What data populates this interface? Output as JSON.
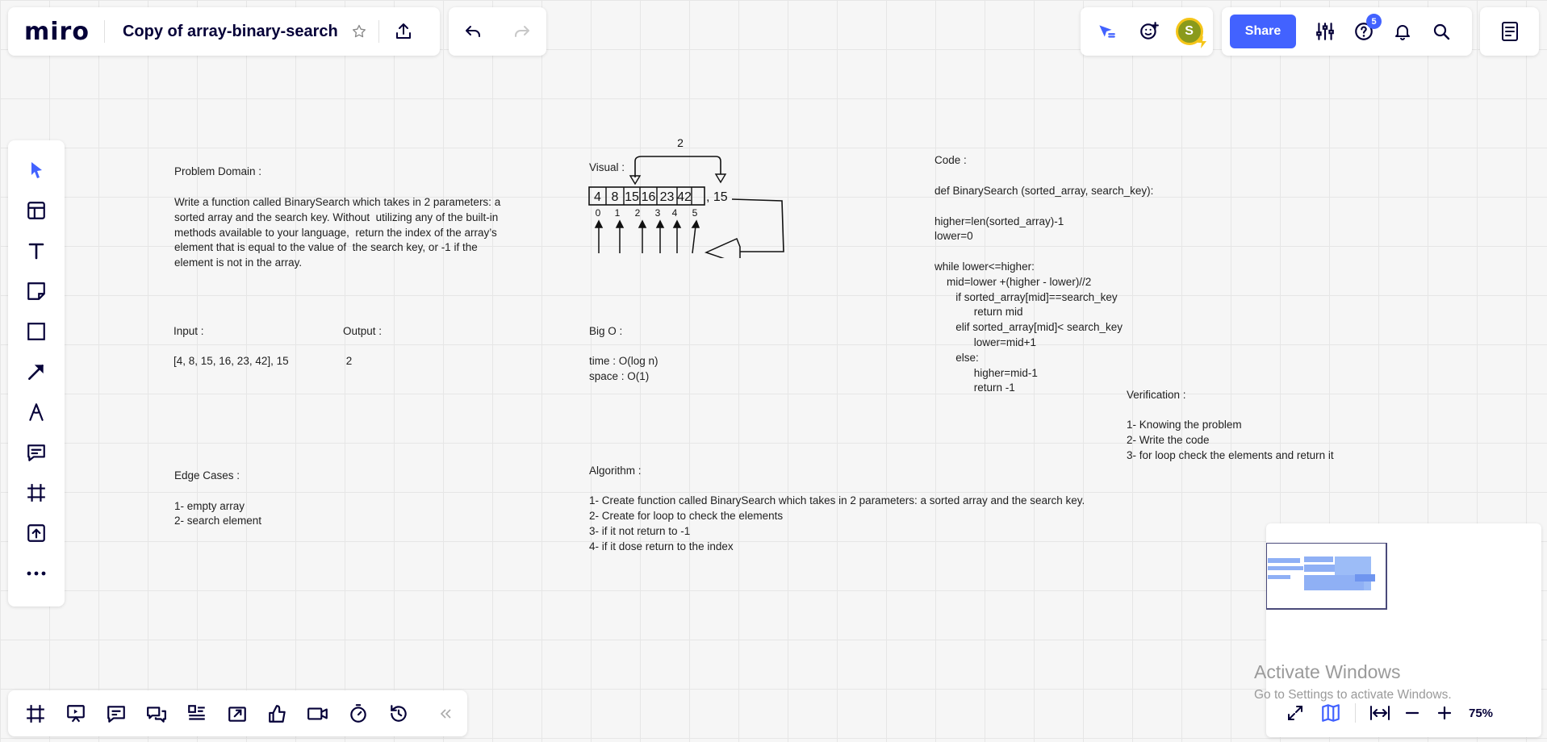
{
  "header": {
    "logo": "miro",
    "board_title": "Copy of array-binary-search",
    "share_label": "Share",
    "help_badge": "5",
    "avatar_initial": "S"
  },
  "board": {
    "problem_domain": {
      "heading": "Problem Domain :",
      "body": "Write a function called BinarySearch which takes in 2 parameters: a\nsorted array and the search key. Without  utilizing any of the built-in\nmethods available to your language,  return the index of the array’s\nelement that is equal to the value of  the search key, or -1 if the\nelement is not in the array."
    },
    "input": {
      "heading": "Input :",
      "value": "[4, 8, 15, 16, 23, 42], 15"
    },
    "output": {
      "heading": "Output :",
      "value": " 2"
    },
    "edge_cases": {
      "heading": "Edge Cases :",
      "items": [
        "1- empty array",
        "2- search element"
      ]
    },
    "visual": {
      "heading": "Visual :",
      "top_label": "2",
      "cells": [
        "4",
        "8",
        "15",
        "16",
        "23",
        "42"
      ],
      "suffix": ", 15",
      "indices": [
        "0",
        "1",
        "2",
        "3",
        "4",
        "5"
      ]
    },
    "big_o": {
      "heading": "Big O :",
      "time": "time : O(log n)",
      "space": "space : O(1)"
    },
    "algorithm": {
      "heading": "Algorithm :",
      "steps": [
        "1- Create function called BinarySearch which takes in 2 parameters: a sorted array and the search key.",
        "2- Create for loop to check the elements",
        "3- if it not return to -1",
        "4- if it dose return to the index"
      ]
    },
    "code": {
      "heading": "Code :",
      "body": "def BinarySearch (sorted_array, search_key):\n\nhigher=len(sorted_array)-1\nlower=0\n\nwhile lower<=higher:\n    mid=lower +(higher - lower)//2\n       if sorted_array[mid]==search_key\n             return mid\n       elif sorted_array[mid]< search_key\n             lower=mid+1\n       else:\n             higher=mid-1\n             return -1"
    },
    "verification": {
      "heading": "Verification :",
      "items": [
        "1- Knowing the problem",
        "2- Write the code",
        "3- for loop check the elements and return it"
      ]
    }
  },
  "zoom_level": "75%",
  "watermark": {
    "title": "Activate Windows",
    "subtitle": "Go to Settings to activate Windows."
  },
  "colors": {
    "accent": "#4262ff",
    "ink": "#050038",
    "avatar": "#8a9a1c"
  }
}
